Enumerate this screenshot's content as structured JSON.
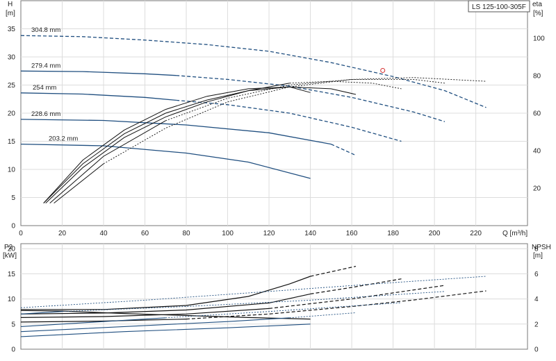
{
  "chart_data": [
    {
      "type": "line",
      "title": "LS 125-100-305F",
      "y_left": {
        "label": "H",
        "unit": "[m]",
        "range": [
          0,
          40
        ],
        "ticks": [
          0,
          5,
          10,
          15,
          20,
          25,
          30,
          35
        ]
      },
      "y_right": {
        "label": "eta",
        "unit": "[%]",
        "range": [
          0,
          120
        ],
        "ticks": [
          20,
          40,
          60,
          80,
          100
        ]
      },
      "x": {
        "label": "Q [m³/h]",
        "range": [
          0,
          245
        ],
        "ticks": [
          0,
          20,
          40,
          60,
          80,
          100,
          120,
          140,
          160,
          180,
          200,
          220
        ]
      },
      "grid": true,
      "operating_point": {
        "q": 175,
        "h": 27.6
      },
      "head_curves": [
        {
          "name": "304.8 mm",
          "solid": [],
          "dashed": [
            [
              0,
              33.8
            ],
            [
              30,
              33.6
            ],
            [
              60,
              33.0
            ],
            [
              90,
              32.2
            ],
            [
              120,
              31.0
            ],
            [
              150,
              29.0
            ],
            [
              180,
              26.5
            ],
            [
              205,
              24.0
            ],
            [
              225,
              21.0
            ]
          ]
        },
        {
          "name": "279.4 mm",
          "solid": [
            [
              0,
              27.5
            ],
            [
              30,
              27.4
            ],
            [
              60,
              27.0
            ],
            [
              75,
              26.7
            ]
          ],
          "dashed": [
            [
              75,
              26.7
            ],
            [
              100,
              26.0
            ],
            [
              130,
              24.8
            ],
            [
              160,
              22.8
            ],
            [
              190,
              20.2
            ],
            [
              205,
              18.5
            ]
          ]
        },
        {
          "name": "254 mm",
          "solid": [
            [
              0,
              23.6
            ],
            [
              30,
              23.4
            ],
            [
              60,
              22.8
            ],
            [
              75,
              22.3
            ]
          ],
          "dashed": [
            [
              75,
              22.3
            ],
            [
              100,
              21.5
            ],
            [
              130,
              20.0
            ],
            [
              160,
              17.5
            ],
            [
              184,
              15.0
            ]
          ]
        },
        {
          "name": "228.6 mm",
          "solid": [
            [
              0,
              18.9
            ],
            [
              40,
              18.7
            ],
            [
              80,
              17.9
            ],
            [
              120,
              16.5
            ],
            [
              150,
              14.5
            ]
          ],
          "dashed": [
            [
              150,
              14.5
            ],
            [
              162,
              12.5
            ]
          ]
        },
        {
          "name": "203.2 mm",
          "solid": [
            [
              0,
              14.5
            ],
            [
              40,
              14.2
            ],
            [
              80,
              12.9
            ],
            [
              110,
              11.3
            ],
            [
              140,
              8.4
            ]
          ],
          "dashed": []
        }
      ],
      "efficiency_curves": [
        {
          "solid": [
            [
              11,
              12
            ],
            [
              30,
              35
            ],
            [
              50,
              51
            ],
            [
              70,
              62
            ],
            [
              90,
              69
            ],
            [
              110,
              73
            ],
            [
              130,
              74
            ],
            [
              140,
              71
            ]
          ],
          "dashed": []
        },
        {
          "solid": [
            [
              11,
              12
            ],
            [
              30,
              33
            ],
            [
              50,
              49
            ],
            [
              70,
              60
            ],
            [
              90,
              67
            ],
            [
              110,
              72
            ],
            [
              130,
              74
            ],
            [
              150,
              73
            ],
            [
              162,
              70
            ]
          ],
          "dashed": []
        },
        {
          "solid": [
            [
              12,
              12
            ],
            [
              30,
              31
            ],
            [
              50,
              47
            ],
            [
              70,
              58
            ],
            [
              90,
              66
            ],
            [
              110,
              72
            ],
            [
              130,
              76
            ]
          ],
          "dashed": [
            [
              130,
              76
            ],
            [
              150,
              77
            ],
            [
              170,
              76
            ],
            [
              184,
              73
            ]
          ]
        },
        {
          "solid": [
            [
              14,
              12
            ],
            [
              40,
              37
            ],
            [
              70,
              56
            ]
          ],
          "dashed": [
            [
              70,
              56
            ],
            [
              100,
              68
            ],
            [
              130,
              75
            ],
            [
              160,
              78
            ],
            [
              190,
              78
            ],
            [
              205,
              76
            ]
          ]
        },
        {
          "solid": [
            [
              16,
              12
            ],
            [
              40,
              33
            ]
          ],
          "dashed": [
            [
              40,
              33
            ],
            [
              70,
              52
            ],
            [
              100,
              66
            ],
            [
              130,
              74
            ],
            [
              160,
              78
            ],
            [
              190,
              79
            ],
            [
              225,
              77
            ]
          ]
        }
      ]
    },
    {
      "type": "line",
      "y_left": {
        "label": "P2",
        "unit": "[kW]",
        "range": [
          0,
          21
        ],
        "ticks": [
          0,
          5,
          10,
          15,
          20
        ]
      },
      "y_right": {
        "label": "NPSH",
        "unit": "[m]",
        "range": [
          0,
          8.4
        ],
        "ticks": [
          0,
          2,
          4,
          6,
          8
        ]
      },
      "x": {
        "range": [
          0,
          245
        ],
        "ticks": [
          0,
          20,
          40,
          60,
          80,
          100,
          120,
          140,
          160,
          180,
          200,
          220
        ]
      },
      "grid": true,
      "power_curves": [
        {
          "solid": [
            [
              0,
              7.9
            ],
            [
              40,
              7.9
            ],
            [
              80,
              8.7
            ],
            [
              110,
              10.5
            ],
            [
              130,
              13.0
            ],
            [
              140,
              14.5
            ]
          ],
          "dashed": [
            [
              140,
              14.5
            ],
            [
              162,
              16.5
            ]
          ]
        },
        {
          "solid": [
            [
              0,
              7.0
            ],
            [
              40,
              7.2
            ],
            [
              80,
              7.8
            ],
            [
              120,
              9.2
            ],
            [
              140,
              11.0
            ]
          ],
          "dashed": [
            [
              140,
              11.0
            ],
            [
              160,
              12.3
            ],
            [
              184,
              14.0
            ]
          ]
        },
        {
          "solid": [
            [
              0,
              6.3
            ],
            [
              40,
              6.5
            ],
            [
              80,
              7.0
            ],
            [
              120,
              8.1
            ]
          ],
          "dashed": [
            [
              120,
              8.1
            ],
            [
              160,
              10.0
            ],
            [
              190,
              11.8
            ],
            [
              205,
              12.7
            ]
          ]
        },
        {
          "solid": [
            [
              0,
              5.4
            ],
            [
              40,
              5.6
            ],
            [
              80,
              6.0
            ]
          ],
          "dashed": [
            [
              80,
              6.0
            ],
            [
              120,
              7.0
            ],
            [
              160,
              8.5
            ],
            [
              190,
              9.8
            ],
            [
              225,
              11.6
            ]
          ]
        },
        {
          "solid": [
            [
              0,
              7.7
            ],
            [
              20,
              7.6
            ],
            [
              50,
              7.1
            ],
            [
              80,
              6.7
            ],
            [
              110,
              6.3
            ],
            [
              140,
              6.0
            ]
          ],
          "dashed": []
        }
      ],
      "npsh_curves": [
        {
          "solid": [
            [
              0,
              1.0
            ],
            [
              50,
              1.4
            ],
            [
              100,
              1.7
            ],
            [
              140,
              2.0
            ]
          ],
          "dashed": []
        },
        {
          "solid": [
            [
              0,
              1.4
            ],
            [
              50,
              1.8
            ],
            [
              100,
              2.2
            ],
            [
              130,
              2.5
            ]
          ],
          "dashed": [
            [
              130,
              2.5
            ],
            [
              162,
              2.9
            ]
          ]
        },
        {
          "solid": [
            [
              0,
              1.8
            ],
            [
              40,
              2.2
            ],
            [
              70,
              2.5
            ]
          ],
          "dashed": [
            [
              70,
              2.5
            ],
            [
              120,
              3.0
            ],
            [
              184,
              3.7
            ]
          ]
        },
        {
          "solid": [
            [
              0,
              2.8
            ],
            [
              20,
              3.0
            ]
          ],
          "dashed": [
            [
              20,
              3.0
            ],
            [
              80,
              3.4
            ],
            [
              140,
              3.9
            ],
            [
              205,
              4.6
            ]
          ]
        },
        {
          "solid": [],
          "dashed": [
            [
              0,
              3.3
            ],
            [
              60,
              3.9
            ],
            [
              120,
              4.6
            ],
            [
              180,
              5.3
            ],
            [
              225,
              5.8
            ]
          ]
        }
      ]
    }
  ]
}
